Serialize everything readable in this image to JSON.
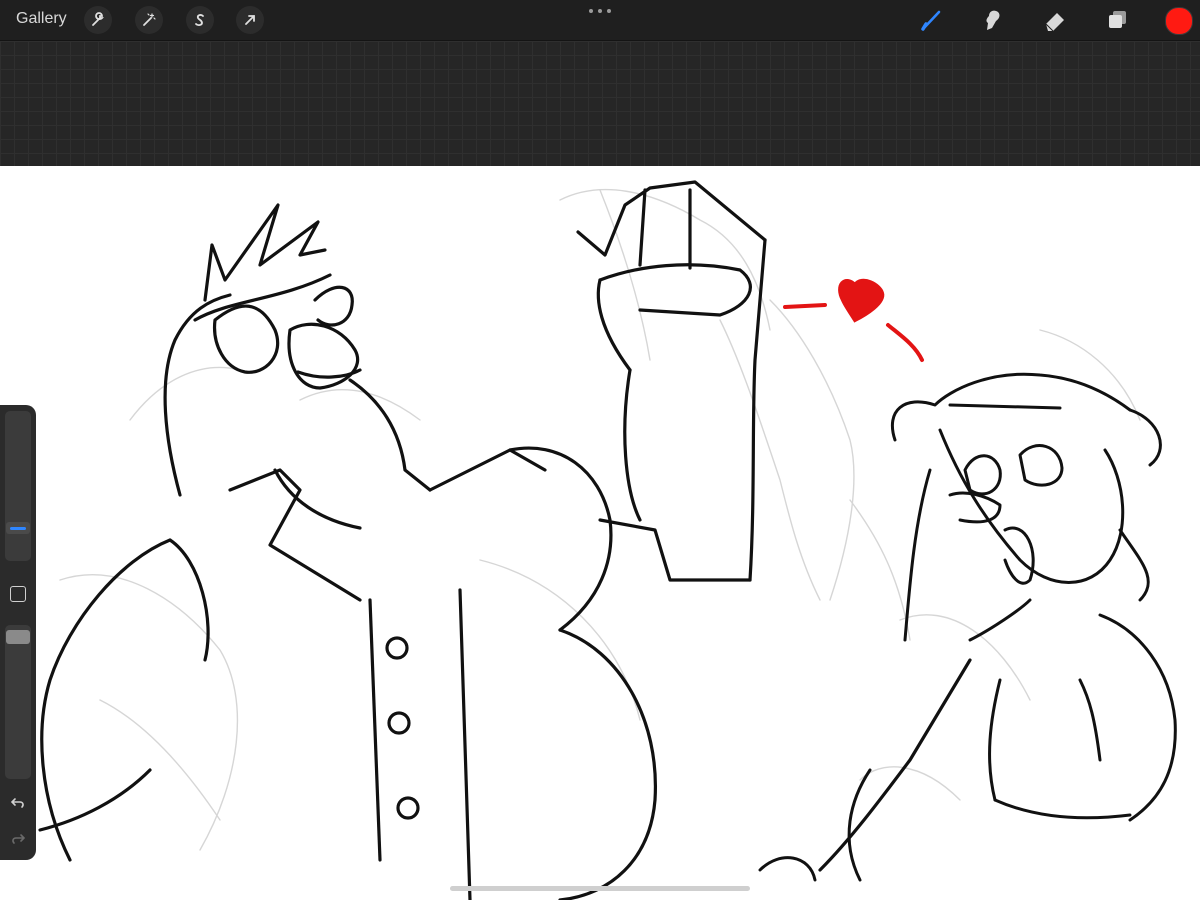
{
  "app": {
    "gallery_label": "Gallery"
  },
  "toolbar": {
    "left_tools": [
      "wrench-icon",
      "magic-wand-icon",
      "selection-s-icon",
      "transform-arrow-icon"
    ],
    "more_menu": "dots-icon",
    "right_tools": [
      "brush-icon",
      "smudge-icon",
      "eraser-icon",
      "layers-icon"
    ],
    "active_tool": "brush",
    "active_tool_color": "#2f86ff",
    "current_color": "#ff1a12"
  },
  "sidebar": {
    "brush_size_level": 0.27,
    "opacity_level": 0.97,
    "controls": [
      "brush-size-slider",
      "modify-button",
      "opacity-slider",
      "undo-icon",
      "redo-icon"
    ]
  },
  "canvas": {
    "background": "#ffffff",
    "accent_heart_color": "#e31414",
    "description_icon": "sketch-artwork"
  }
}
